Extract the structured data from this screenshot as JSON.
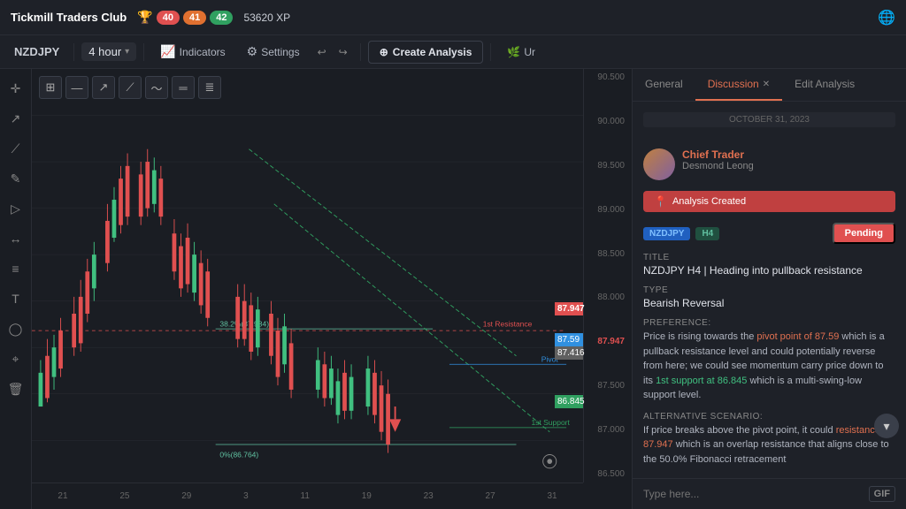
{
  "header": {
    "brand": "Tickmill Traders Club",
    "badges": [
      {
        "value": "40",
        "class": "badge-red"
      },
      {
        "value": "41",
        "class": "badge-orange"
      },
      {
        "value": "42",
        "class": "badge-green"
      }
    ],
    "xp": "53620 XP"
  },
  "toolbar": {
    "pair": "NZDJPY",
    "timeframe": "4 hour",
    "indicators_label": "Indicators",
    "settings_label": "Settings",
    "create_label": "Create Analysis"
  },
  "chart": {
    "price_levels": [
      "90.500",
      "90.000",
      "89.500",
      "89.000",
      "88.500",
      "88.000",
      "87.500",
      "87.000",
      "86.500"
    ],
    "time_labels": [
      "21",
      "25",
      "29",
      "3",
      "11",
      "19",
      "23",
      "27",
      "31"
    ],
    "annotations": {
      "resistance": "1st Resistance",
      "pivot": "Pivot",
      "support": "1st Support",
      "fib382": "38.2%(87.984)",
      "fib0": "0%(86.764)",
      "price_87947": "87.947",
      "price_8759": "87.59",
      "price_8741": "87.416",
      "price_86845": "86.845"
    }
  },
  "panel": {
    "tabs": [
      {
        "label": "General",
        "active": false
      },
      {
        "label": "Discussion",
        "active": true,
        "closeable": true
      },
      {
        "label": "Edit Analysis",
        "active": false
      }
    ],
    "date_separator": "OCTOBER 31, 2023",
    "poster": {
      "name": "Chief Trader",
      "sub": "Desmond Leong"
    },
    "analysis_badge": "Analysis Created",
    "tags": [
      "NZDJPY",
      "H4"
    ],
    "pending": "Pending",
    "title_label": "Title",
    "title_value": "NZDJPY H4 | Heading into pullback resistance",
    "type_label": "Type",
    "type_value": "Bearish Reversal",
    "preference_label": "Preference:",
    "preference_text": "Price is rising towards the pivot point of 87.59 which is a pullback resistance level and could potentially reverse from here; we could see momentum carry price down to its 1st support at 86.845 which is a multi-swing-low support level.",
    "alt_scenario_label": "Alternative Scenario:",
    "alt_scenario_text": "If price breaks above the pivot point, it could resistance at 87.947 which is an overlap resistance that aligns close to the 50.0% Fibonacci retracement",
    "message_placeholder": "Type here...",
    "gif_label": "GIF"
  }
}
